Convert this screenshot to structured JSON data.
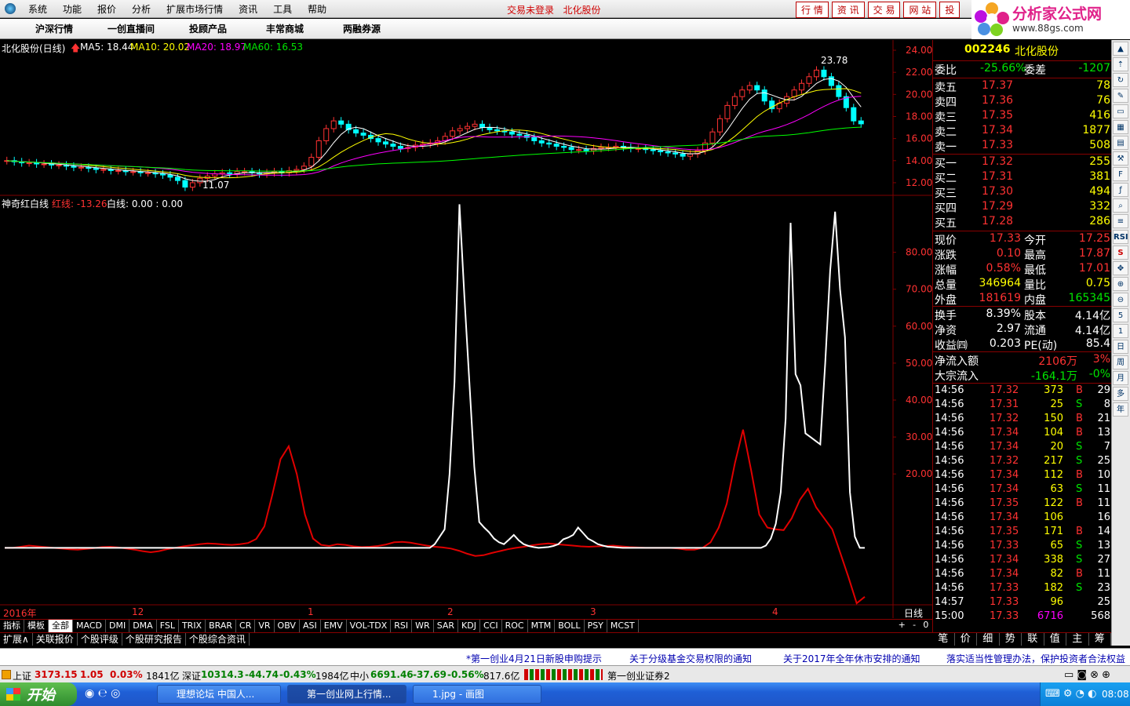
{
  "menu": {
    "items": [
      "系统",
      "功能",
      "报价",
      "分析",
      "扩展市场行情",
      "资讯",
      "工具",
      "帮助"
    ],
    "status1": "交易未登录",
    "status2": "北化股份",
    "quick_buttons": [
      "行 情",
      "资 讯",
      "交 易",
      "网 站",
      "投"
    ]
  },
  "brand": {
    "name": "分析家公式网",
    "url": "www.88gs.com"
  },
  "toolbar": {
    "items": [
      "沪深行情",
      "一创直播间",
      "投顾产品",
      "丰常商城",
      "两融券源"
    ]
  },
  "chart_header": {
    "stock": "北化股份(日线)",
    "ma5": "MA5: 18.44",
    "ma10": "MA10: 20.02",
    "ma20": "MA20: 18.97",
    "ma60": "MA60: 16.53",
    "max_label": "23.78",
    "min_label": "11.07"
  },
  "indicator_header": {
    "name": "神奇红白线",
    "red": "红线: -13.26",
    "white": "白线: 0.00 : 0.00"
  },
  "xaxis": {
    "labels": [
      "2016年",
      "12",
      "1",
      "2",
      "3",
      "4"
    ],
    "period": "日线"
  },
  "colors": {
    "up": "#ff3232",
    "down": "#00ffff",
    "ma5": "#ffffff",
    "ma10": "#ffff00",
    "ma20": "#ff00ff",
    "ma60": "#00ff00",
    "grid": "#800000"
  },
  "chart_data": [
    {
      "type": "candlestick",
      "yaxis": {
        "ticks": [
          "24.00",
          "22.00",
          "20.00",
          "18.00",
          "16.00",
          "14.00",
          "12.00"
        ],
        "ylim": [
          11,
          24.5
        ]
      },
      "series": [
        {
          "name": "MA5"
        },
        {
          "name": "MA10"
        },
        {
          "name": "MA20"
        },
        {
          "name": "MA60"
        }
      ],
      "close": [
        14.0,
        13.9,
        13.8,
        13.8,
        13.7,
        13.7,
        13.6,
        13.6,
        13.5,
        13.4,
        13.4,
        13.3,
        13.2,
        13.2,
        13.1,
        13.1,
        13.0,
        13.0,
        12.9,
        12.9,
        12.8,
        12.7,
        12.5,
        12.2,
        11.6,
        12.0,
        12.4,
        12.6,
        12.8,
        12.9,
        12.8,
        13.0,
        13.0,
        12.9,
        12.8,
        12.9,
        13.0,
        12.9,
        13.1,
        13.2,
        13.5,
        14.3,
        15.8,
        16.9,
        17.6,
        17.3,
        16.8,
        16.5,
        16.3,
        16.0,
        15.7,
        15.5,
        15.3,
        15.1,
        15.2,
        15.4,
        15.5,
        15.6,
        15.8,
        16.2,
        16.7,
        16.9,
        17.1,
        17.3,
        17.0,
        16.8,
        16.7,
        16.6,
        16.4,
        16.3,
        16.1,
        15.8,
        15.6,
        15.5,
        15.3,
        15.2,
        15.0,
        15.0,
        14.9,
        15.1,
        15.2,
        15.2,
        15.3,
        15.2,
        15.1,
        15.1,
        15.0,
        14.9,
        14.8,
        14.7,
        14.6,
        14.4,
        14.6,
        14.9,
        15.6,
        16.6,
        17.8,
        19.0,
        19.8,
        20.4,
        20.8,
        20.4,
        19.4,
        18.7,
        19.2,
        19.8,
        20.4,
        21.0,
        21.6,
        22.2,
        21.6,
        20.8,
        19.8,
        18.8,
        17.6,
        17.33
      ]
    },
    {
      "type": "line",
      "yaxis": {
        "ticks": [
          "80.00",
          "70.00",
          "60.00",
          "50.00",
          "40.00",
          "30.00",
          "20.00"
        ],
        "ylim": [
          -15,
          95
        ]
      },
      "series": [
        {
          "name": "红线",
          "values": [
            0,
            0,
            0.3,
            0.6,
            0.4,
            0.2,
            0,
            -0.2,
            -0.4,
            -0.5,
            -0.3,
            -0.1,
            0.2,
            0.3,
            0.1,
            -0.2,
            -0.5,
            -0.9,
            -1.2,
            -0.9,
            -0.4,
            0,
            0.4,
            0.7,
            1.0,
            1.2,
            1.1,
            0.9,
            0.8,
            1.0,
            1.3,
            2.4,
            5.8,
            14.5,
            24.0,
            27.5,
            20.0,
            9.0,
            2.5,
            0.8,
            0.5,
            1.0,
            0.8,
            0.4,
            0.2,
            0.3,
            0.5,
            0.9,
            1.5,
            1.6,
            1.4,
            1.0,
            0.6,
            0.3,
            0.1,
            -0.2,
            -0.8,
            -1.6,
            -2.2,
            -2.0,
            -1.4,
            -0.9,
            -0.4,
            0,
            0.3,
            0.7,
            1.0,
            1.2,
            1.0,
            0.8,
            0.6,
            0.4,
            0.3,
            0.4,
            0.5,
            0.6,
            0.4,
            0.2,
            0.1,
            0,
            0,
            0,
            0,
            -0.2,
            -0.5,
            -0.5,
            0,
            1.5,
            5.5,
            12.0,
            23.0,
            32.0,
            21.0,
            9.0,
            5.5,
            5.0,
            4.8,
            8.0,
            13.0,
            16.0,
            11.0,
            8.0,
            5.0,
            -1.5,
            -8.0,
            -15.0,
            -13.26
          ]
        },
        {
          "name": "白线",
          "values": [
            0,
            0,
            0,
            0,
            0,
            0,
            0,
            0,
            0,
            0,
            0,
            0,
            0,
            0,
            0,
            0,
            0,
            0,
            0,
            0,
            0,
            0,
            0,
            0,
            0,
            0,
            0,
            0,
            0,
            0,
            0,
            0,
            0,
            0,
            0,
            0,
            0,
            0,
            0,
            0,
            0,
            0,
            0,
            0,
            0,
            0,
            0,
            0,
            0,
            0,
            0,
            0,
            0,
            0,
            0,
            0,
            0,
            0,
            0,
            0,
            0,
            0,
            0,
            0,
            0,
            0,
            0,
            0,
            0,
            0,
            0,
            0,
            0,
            0,
            0,
            0,
            0,
            0,
            0,
            0,
            0,
            0,
            0,
            0,
            0,
            0,
            0,
            1.0,
            3.0,
            5.0,
            20.0,
            45.0,
            93.0,
            68.0,
            45.0,
            22.0,
            7.0,
            5.5,
            4.2,
            2.5,
            1.5,
            1.0,
            2.2,
            3.5,
            2.0,
            1.0,
            0.5,
            0.2,
            0,
            0.1,
            0.2,
            0.5,
            1.0,
            2.3,
            2.8,
            3.5,
            5.5,
            4.0,
            2.5,
            1.8,
            1.0,
            0.6,
            0.3,
            0.2,
            0.1,
            0,
            0,
            0,
            0,
            0,
            0,
            0,
            0,
            0,
            0,
            0,
            0,
            0,
            0,
            0,
            0,
            0,
            0,
            0,
            0,
            0,
            0,
            0,
            0,
            0,
            0,
            0,
            0,
            0,
            0.6,
            2.5,
            6.5,
            15.0,
            35.0,
            88.0,
            47.0,
            44.0,
            31.0,
            30.0,
            29.0,
            28.0,
            50.0,
            75.0,
            91.0,
            70.0,
            57.0,
            15.0,
            3.0,
            0,
            0
          ]
        }
      ]
    }
  ],
  "quote": {
    "code": "002246",
    "name": "北化股份",
    "webi_label": "委比",
    "webi": "-25.66%",
    "weicha_label": "委差",
    "weicha": "-1207",
    "asks": [
      {
        "label": "卖五",
        "price": "17.37",
        "vol": "78"
      },
      {
        "label": "卖四",
        "price": "17.36",
        "vol": "76"
      },
      {
        "label": "卖三",
        "price": "17.35",
        "vol": "416"
      },
      {
        "label": "卖二",
        "price": "17.34",
        "vol": "1877"
      },
      {
        "label": "卖一",
        "price": "17.33",
        "vol": "508"
      }
    ],
    "bids": [
      {
        "label": "买一",
        "price": "17.32",
        "vol": "255"
      },
      {
        "label": "买二",
        "price": "17.31",
        "vol": "381"
      },
      {
        "label": "买三",
        "price": "17.30",
        "vol": "494"
      },
      {
        "label": "买四",
        "price": "17.29",
        "vol": "332"
      },
      {
        "label": "买五",
        "price": "17.28",
        "vol": "286"
      }
    ],
    "stats": [
      {
        "l1": "现价",
        "v1": "17.33",
        "l2": "今开",
        "v2": "17.25"
      },
      {
        "l1": "涨跌",
        "v1": "0.10",
        "l2": "最高",
        "v2": "17.87"
      },
      {
        "l1": "涨幅",
        "v1": "0.58%",
        "l2": "最低",
        "v2": "17.01"
      },
      {
        "l1": "总量",
        "v1": "346964",
        "l2": "量比",
        "v2": "0.75"
      },
      {
        "l1": "外盘",
        "v1": "181619",
        "l2": "内盘",
        "v2": "165345"
      }
    ],
    "stats2": [
      {
        "l1": "换手",
        "v1": "8.39%",
        "l2": "股本",
        "v2": "4.14亿"
      },
      {
        "l1": "净资",
        "v1": "2.97",
        "l2": "流通",
        "v2": "4.14亿"
      },
      {
        "l1": "收益㈣",
        "v1": "0.203",
        "l2": "PE(动)",
        "v2": "85.4"
      }
    ],
    "flow": [
      {
        "label": "净流入额",
        "value": "2106万",
        "pct": "3%"
      },
      {
        "label": "大宗流入",
        "value": "-164.1万",
        "pct": "-0%"
      }
    ],
    "ticks": [
      {
        "t": "14:56",
        "p": "17.32",
        "v": "373",
        "bs": "B",
        "n": "29"
      },
      {
        "t": "14:56",
        "p": "17.31",
        "v": "25",
        "bs": "S",
        "n": "8"
      },
      {
        "t": "14:56",
        "p": "17.32",
        "v": "150",
        "bs": "B",
        "n": "21"
      },
      {
        "t": "14:56",
        "p": "17.34",
        "v": "104",
        "bs": "B",
        "n": "13"
      },
      {
        "t": "14:56",
        "p": "17.34",
        "v": "20",
        "bs": "S",
        "n": "7"
      },
      {
        "t": "14:56",
        "p": "17.32",
        "v": "217",
        "bs": "S",
        "n": "25"
      },
      {
        "t": "14:56",
        "p": "17.34",
        "v": "112",
        "bs": "B",
        "n": "10"
      },
      {
        "t": "14:56",
        "p": "17.34",
        "v": "63",
        "bs": "S",
        "n": "11"
      },
      {
        "t": "14:56",
        "p": "17.35",
        "v": "122",
        "bs": "B",
        "n": "11"
      },
      {
        "t": "14:56",
        "p": "17.34",
        "v": "106",
        "bs": "",
        "n": "16"
      },
      {
        "t": "14:56",
        "p": "17.35",
        "v": "171",
        "bs": "B",
        "n": "14"
      },
      {
        "t": "14:56",
        "p": "17.33",
        "v": "65",
        "bs": "S",
        "n": "13"
      },
      {
        "t": "14:56",
        "p": "17.34",
        "v": "338",
        "bs": "S",
        "n": "27"
      },
      {
        "t": "14:56",
        "p": "17.34",
        "v": "82",
        "bs": "B",
        "n": "11"
      },
      {
        "t": "14:56",
        "p": "17.33",
        "v": "182",
        "bs": "S",
        "n": "23"
      },
      {
        "t": "14:57",
        "p": "17.33",
        "v": "96",
        "bs": "",
        "n": "25"
      },
      {
        "t": "15:00",
        "p": "17.33",
        "v": "6716",
        "bs": "",
        "n": "568"
      }
    ]
  },
  "side_icons": [
    "RSI",
    "S",
    "5",
    "1",
    "日",
    "周",
    "月",
    "多",
    "年"
  ],
  "indicator_tabs": [
    "指标",
    "模板",
    "全部",
    "MACD",
    "DMI",
    "DMA",
    "FSL",
    "TRIX",
    "BRAR",
    "CR",
    "VR",
    "OBV",
    "ASI",
    "EMV",
    "VOL-TDX",
    "RSI",
    "WR",
    "SAR",
    "KDJ",
    "CCI",
    "ROC",
    "MTM",
    "BOLL",
    "PSY",
    "MCST"
  ],
  "ext_tabs": [
    "扩展∧",
    "关联报价",
    "个股评级",
    "个股研究报告",
    "个股综合资讯"
  ],
  "right_tabs": [
    "笔",
    "价",
    "细",
    "势",
    "联",
    "值",
    "主",
    "筹"
  ],
  "news": [
    "*第一创业4月21日新股申购提示",
    "关于分级基金交易权限的通知",
    "关于2017年全年休市安排的通知",
    "落实适当性管理办法，保护投资者合法权益"
  ],
  "indices": {
    "sh_label": "上证",
    "sh": "3173.15",
    "sh_chg": "1.05",
    "sh_pct": "0.03%",
    "sh_amt": "1841亿",
    "sz_label": "深证",
    "sz": "10314.3",
    "sz_chg": "-44.74",
    "sz_pct": "-0.43%",
    "sz_amt": "1984亿",
    "zx_label": "中小",
    "zx": "6691.46",
    "zx_chg": "-37.69",
    "zx_pct": "-0.56%",
    "zx_amt": "817.6亿",
    "broker": "第一创业证券2"
  },
  "taskbar": {
    "start": "开始",
    "tasks": [
      "理想论坛 中国人...",
      "第一创业网上行情...",
      "1.jpg - 画图"
    ],
    "time": "08:08"
  }
}
